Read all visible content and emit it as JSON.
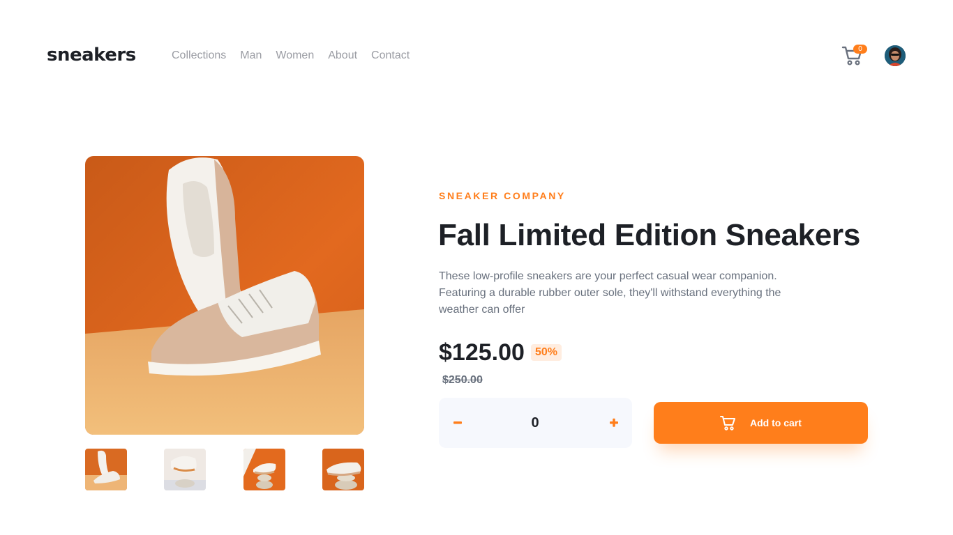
{
  "header": {
    "logo": "sneakers",
    "nav": [
      "Collections",
      "Man",
      "Women",
      "About",
      "Contact"
    ],
    "cart_count": "0",
    "cart_icon": "cart-icon",
    "avatar": "user-avatar"
  },
  "gallery": {
    "main_image": "sneaker-pair-orange-background",
    "thumbnails": [
      "sneaker-thumbnail-1",
      "sneaker-thumbnail-2",
      "sneaker-thumbnail-3",
      "sneaker-thumbnail-4"
    ]
  },
  "product": {
    "company": "SNEAKER COMPANY",
    "title": "Fall Limited Edition Sneakers",
    "description": "These low-profile sneakers are your perfect casual wear companion. Featuring a durable rubber outer sole, they'll withstand everything the weather can offer",
    "price": "$125.00",
    "discount": "50%",
    "original_price": "$250.00"
  },
  "quantity": {
    "value": "0",
    "minus_icon": "minus-icon",
    "plus_icon": "plus-icon"
  },
  "add_to_cart": {
    "label": "Add to cart",
    "icon": "cart-icon"
  },
  "colors": {
    "accent": "#ff7e1b",
    "accent_pale": "#ffede0",
    "dark": "#1d2026",
    "grey_text": "#68707d",
    "nav_text": "#9a9ca3",
    "qty_bg": "#f6f8fd"
  }
}
